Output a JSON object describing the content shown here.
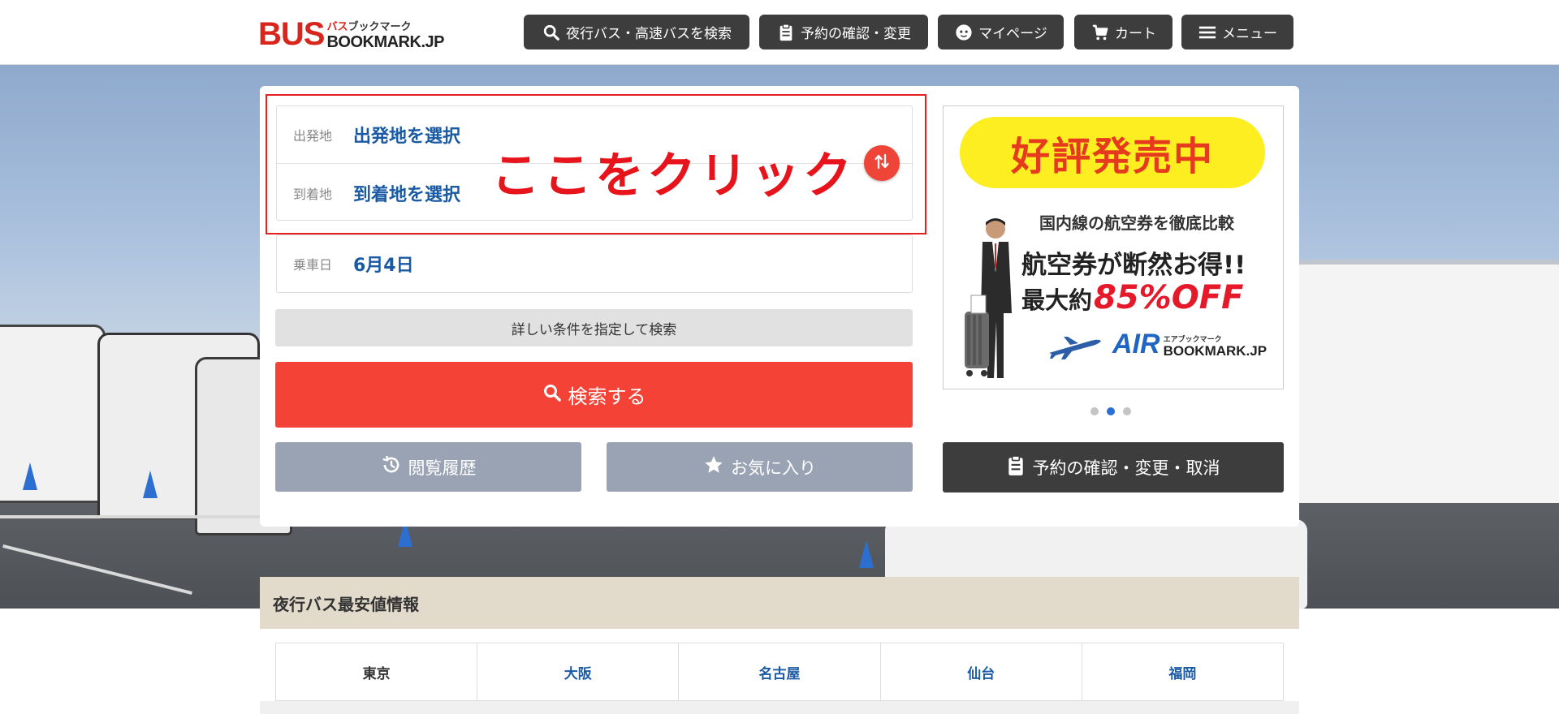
{
  "header": {
    "logo": {
      "main": "BUS",
      "kana_red": "バス",
      "kana_dark": "ブックマーク",
      "domain": "BOOKMARK.JP"
    },
    "nav": [
      {
        "label": "夜行バス・高速バスを検索",
        "icon": "search-icon"
      },
      {
        "label": "予約の確認・変更",
        "icon": "clipboard-icon"
      },
      {
        "label": "マイページ",
        "icon": "user-face-icon"
      },
      {
        "label": "カート",
        "icon": "cart-icon"
      },
      {
        "label": "メニュー",
        "icon": "menu-icon"
      }
    ]
  },
  "search": {
    "departure": {
      "label": "出発地",
      "value": "出発地を選択"
    },
    "arrival": {
      "label": "到着地",
      "value": "到着地を選択"
    },
    "date": {
      "label": "乗車日",
      "value": "6月4日"
    },
    "detail_button": "詳しい条件を指定して検索",
    "search_button": "検索する",
    "history_button": "閲覧履歴",
    "favorites_button": "お気に入り",
    "annotation": "ここをクリック"
  },
  "ad": {
    "badge": "好評発売中",
    "line1": "国内線の航空券を徹底比較",
    "line2": "航空券が断然お得!!",
    "line3_prefix": "最大約",
    "line3_highlight": "85%OFF",
    "brand_main": "AIR",
    "brand_kana": "エアブックマーク",
    "brand_domain": "BOOKMARK.JP",
    "carousel": {
      "count": 3,
      "active_index": 1
    }
  },
  "confirm_button": "予約の確認・変更・取消",
  "cheapest": {
    "title": "夜行バス最安値情報",
    "cities": [
      "東京",
      "大阪",
      "名古屋",
      "仙台",
      "福岡"
    ],
    "active_city": "東京"
  },
  "colors": {
    "brand_red": "#d9261c",
    "search_red": "#f44336",
    "link_blue": "#1a5aa5",
    "nav_dark": "#3d3d3d",
    "grey_button": "#9aa3b3",
    "section_beige": "#e2dacb"
  }
}
